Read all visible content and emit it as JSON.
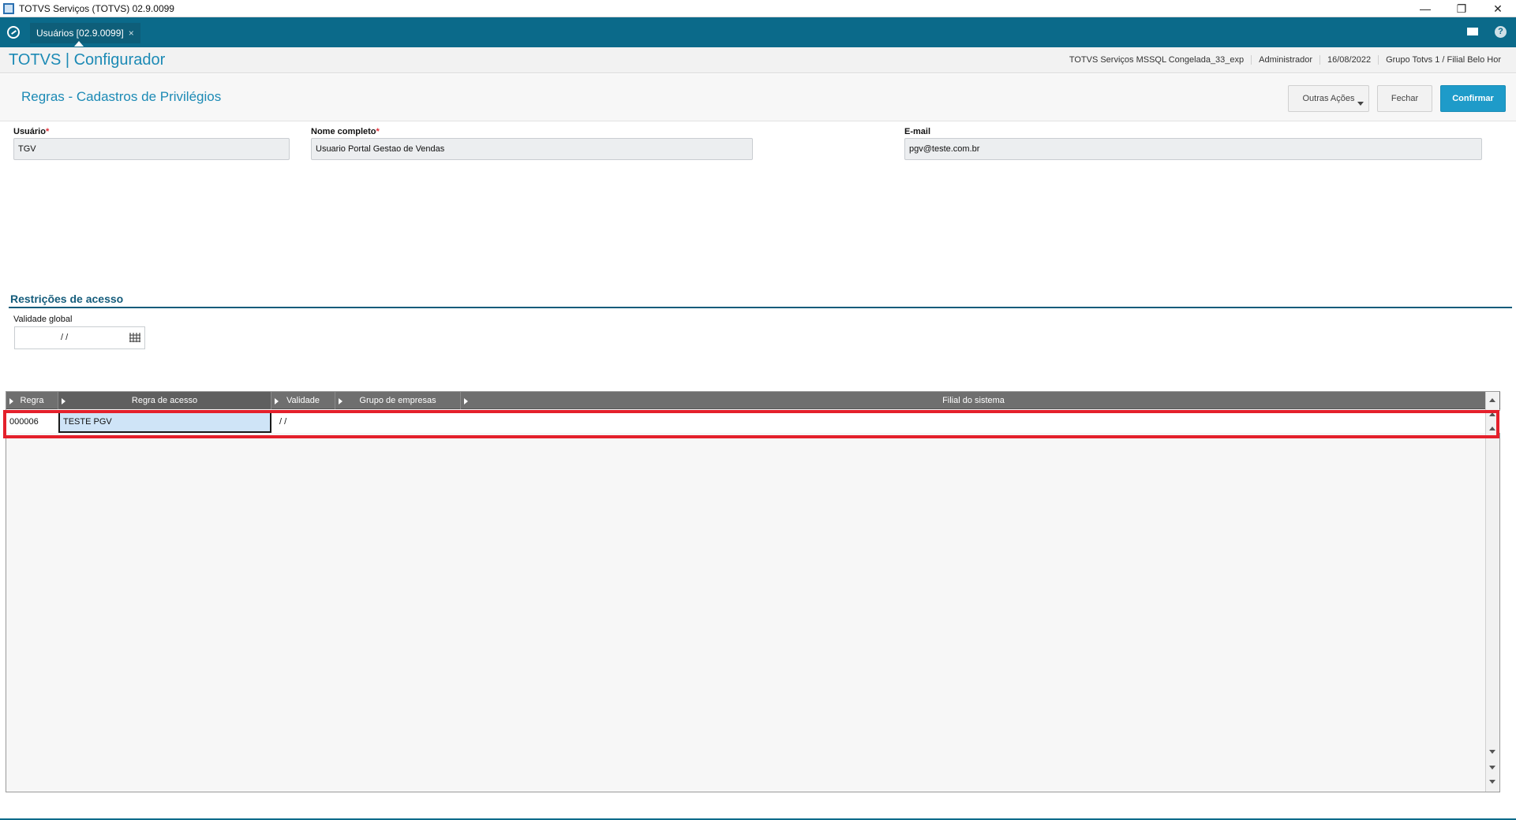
{
  "window": {
    "title": "TOTVS Serviços (TOTVS) 02.9.0099",
    "controls": [
      "—",
      "❐",
      "✕"
    ]
  },
  "tabbar": {
    "tab_label": "Usuários [02.9.0099]",
    "tab_close": "×",
    "help": "?"
  },
  "header": {
    "brand": "TOTVS | Configurador",
    "environment": "TOTVS Serviços MSSQL Congelada_33_exp",
    "user": "Administrador",
    "date": "16/08/2022",
    "company": "Grupo Totvs 1 / Filial Belo Hor"
  },
  "page": {
    "title": "Regras - Cadastros de Privilégios",
    "buttons": {
      "other_actions": "Outras Ações",
      "close": "Fechar",
      "confirm": "Confirmar"
    }
  },
  "form": {
    "usuario": {
      "label": "Usuário",
      "required": "*",
      "value": "TGV"
    },
    "nome": {
      "label": "Nome completo",
      "required": "*",
      "value": "Usuario Portal Gestao de Vendas"
    },
    "email": {
      "label": "E-mail",
      "value": "pgv@teste.com.br"
    }
  },
  "restrictions": {
    "section_title": "Restrições de acesso",
    "validity_label": "Validade global",
    "validity_value": "/ /"
  },
  "grid": {
    "columns": [
      "Regra",
      "Regra de acesso",
      "Validade",
      "Grupo de empresas",
      "Filial do sistema"
    ],
    "rows": [
      {
        "regra": "000006",
        "regra_acesso": "TESTE PGV",
        "validade": "/ /",
        "grupo": "",
        "filial": ""
      }
    ]
  },
  "colors": {
    "accent": "#1c8ab5",
    "tabbar": "#0b6a8a",
    "primary_button": "#1e9bc9",
    "highlight": "#e4202b"
  }
}
